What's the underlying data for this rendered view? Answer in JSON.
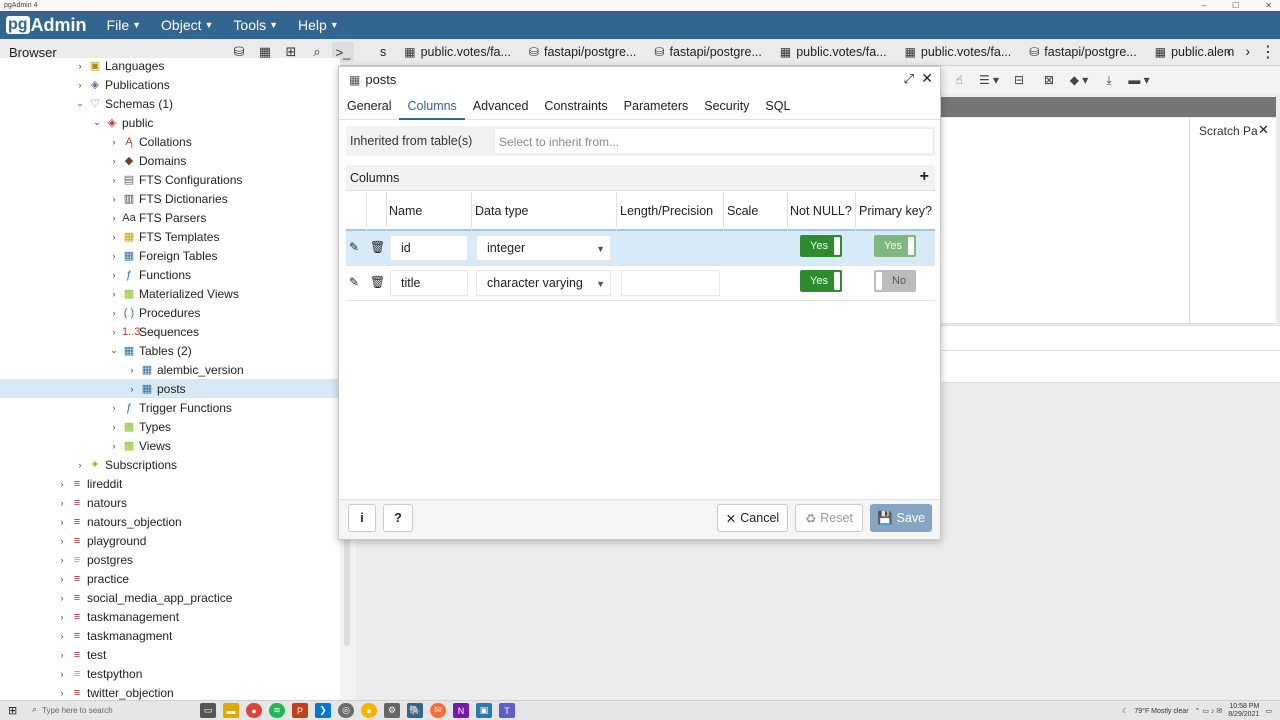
{
  "os": {
    "app_label": "pgAdmin 4"
  },
  "menubar": {
    "logo_pg": "pg",
    "logo_admin": "Admin",
    "items": [
      "File",
      "Object",
      "Tools",
      "Help"
    ]
  },
  "browser": {
    "title": "Browser"
  },
  "toolbar_icons": [
    "database-icon",
    "table-icon",
    "filter-icon",
    "search-icon",
    "terminal-icon"
  ],
  "tabs": [
    {
      "label": "s",
      "icon": "none"
    },
    {
      "label": "public.votes/fa...",
      "icon": "table-icon"
    },
    {
      "label": "fastapi/postgre...",
      "icon": "database-icon"
    },
    {
      "label": "fastapi/postgre...",
      "icon": "database-icon"
    },
    {
      "label": "public.votes/fa...",
      "icon": "table-icon"
    },
    {
      "label": "public.votes/fa...",
      "icon": "table-icon"
    },
    {
      "label": "fastapi/postgre...",
      "icon": "database-icon"
    },
    {
      "label": "public.alem",
      "icon": "table-icon"
    }
  ],
  "tree": [
    {
      "label": "Languages",
      "level": 2,
      "chev": ">",
      "icon": "▣",
      "color": "#b58d00"
    },
    {
      "label": "Publications",
      "level": 2,
      "chev": ">",
      "icon": "◈",
      "color": "#5a6fa8"
    },
    {
      "label": "Schemas (1)",
      "level": 2,
      "chev": "v",
      "icon": "♡",
      "color": "#c0392b"
    },
    {
      "label": "public",
      "level": 3,
      "chev": "v",
      "icon": "◈",
      "color": "#c0392b"
    },
    {
      "label": "Collations",
      "level": 4,
      "chev": ">",
      "icon": "Ą",
      "color": "#c0392b"
    },
    {
      "label": "Domains",
      "level": 4,
      "chev": ">",
      "icon": "◆",
      "color": "#7a3b2e"
    },
    {
      "label": "FTS Configurations",
      "level": 4,
      "chev": ">",
      "icon": "▤",
      "color": "#666"
    },
    {
      "label": "FTS Dictionaries",
      "level": 4,
      "chev": ">",
      "icon": "▥",
      "color": "#444"
    },
    {
      "label": "FTS Parsers",
      "level": 4,
      "chev": ">",
      "icon": "Aa",
      "color": "#333"
    },
    {
      "label": "FTS Templates",
      "level": 4,
      "chev": ">",
      "icon": "▦",
      "color": "#c9a400"
    },
    {
      "label": "Foreign Tables",
      "level": 4,
      "chev": ">",
      "icon": "▦",
      "color": "#2e6fa8"
    },
    {
      "label": "Functions",
      "level": 4,
      "chev": ">",
      "icon": "ƒ",
      "color": "#2e6fa8"
    },
    {
      "label": "Materialized Views",
      "level": 4,
      "chev": ">",
      "icon": "▩",
      "color": "#8dbf2e"
    },
    {
      "label": "Procedures",
      "level": 4,
      "chev": ">",
      "icon": "( )",
      "color": "#2e6fa8"
    },
    {
      "label": "Sequences",
      "level": 4,
      "chev": ">",
      "icon": "1..3",
      "color": "#c0392b"
    },
    {
      "label": "Tables (2)",
      "level": 4,
      "chev": "v",
      "icon": "▦",
      "color": "#2e6fa8"
    },
    {
      "label": "alembic_version",
      "level": 5,
      "chev": ">",
      "icon": "▦",
      "color": "#2e6fa8"
    },
    {
      "label": "posts",
      "level": 5,
      "chev": ">",
      "icon": "▦",
      "color": "#2e6fa8",
      "selected": true
    },
    {
      "label": "Trigger Functions",
      "level": 4,
      "chev": ">",
      "icon": "ƒ",
      "color": "#2e6fa8"
    },
    {
      "label": "Types",
      "level": 4,
      "chev": ">",
      "icon": "▩",
      "color": "#8dbf2e"
    },
    {
      "label": "Views",
      "level": 4,
      "chev": ">",
      "icon": "▩",
      "color": "#8dbf2e"
    },
    {
      "label": "Subscriptions",
      "level": 2,
      "chev": ">",
      "icon": "✦",
      "color": "#c9a400"
    },
    {
      "label": "lireddit",
      "level": 1,
      "chev": ">",
      "icon": "≡",
      "color": "#a33"
    },
    {
      "label": "natours",
      "level": 1,
      "chev": ">",
      "icon": "≡",
      "color": "#a33"
    },
    {
      "label": "natours_objection",
      "level": 1,
      "chev": ">",
      "icon": "≡",
      "color": "#a33"
    },
    {
      "label": "playground",
      "level": 1,
      "chev": ">",
      "icon": "≡",
      "color": "#a33"
    },
    {
      "label": "postgres",
      "level": 1,
      "chev": ">",
      "icon": "≡",
      "color": "#c9a400"
    },
    {
      "label": "practice",
      "level": 1,
      "chev": ">",
      "icon": "≡",
      "color": "#a33"
    },
    {
      "label": "social_media_app_practice",
      "level": 1,
      "chev": ">",
      "icon": "≡",
      "color": "#a33"
    },
    {
      "label": "taskmanagement",
      "level": 1,
      "chev": ">",
      "icon": "≡",
      "color": "#a33"
    },
    {
      "label": "taskmanagment",
      "level": 1,
      "chev": ">",
      "icon": "≡",
      "color": "#a33"
    },
    {
      "label": "test",
      "level": 1,
      "chev": ">",
      "icon": "≡",
      "color": "#a33"
    },
    {
      "label": "testpython",
      "level": 1,
      "chev": ">",
      "icon": "≡",
      "color": "#c9a400"
    },
    {
      "label": "twitter_objection",
      "level": 1,
      "chev": ">",
      "icon": "≡",
      "color": "#a33"
    }
  ],
  "workspace": {
    "scratch_title": "Scratch Pa"
  },
  "dialog": {
    "title": "posts",
    "tabs": [
      "General",
      "Columns",
      "Advanced",
      "Constraints",
      "Parameters",
      "Security",
      "SQL"
    ],
    "active_tab": "Columns",
    "inherit_label": "Inherited from table(s)",
    "inherit_placeholder": "Select to inherit from...",
    "columns_title": "Columns",
    "grid_headers": [
      "Name",
      "Data type",
      "Length/Precision",
      "Scale",
      "Not NULL?",
      "Primary key?"
    ],
    "rows": [
      {
        "name": "id",
        "data_type": "integer",
        "length": "",
        "scale": "",
        "not_null": "Yes",
        "primary_key": "Yes"
      },
      {
        "name": "title",
        "data_type": "character varying",
        "length": "",
        "scale": "",
        "not_null": "Yes",
        "primary_key": "No"
      }
    ],
    "footer": {
      "info": "i",
      "help": "?",
      "cancel": "Cancel",
      "reset": "Reset",
      "save": "Save"
    }
  },
  "taskbar": {
    "search_placeholder": "Type here to search",
    "weather": "79°F  Mostly clear",
    "time": "10:58 PM",
    "date": "8/29/2021"
  }
}
